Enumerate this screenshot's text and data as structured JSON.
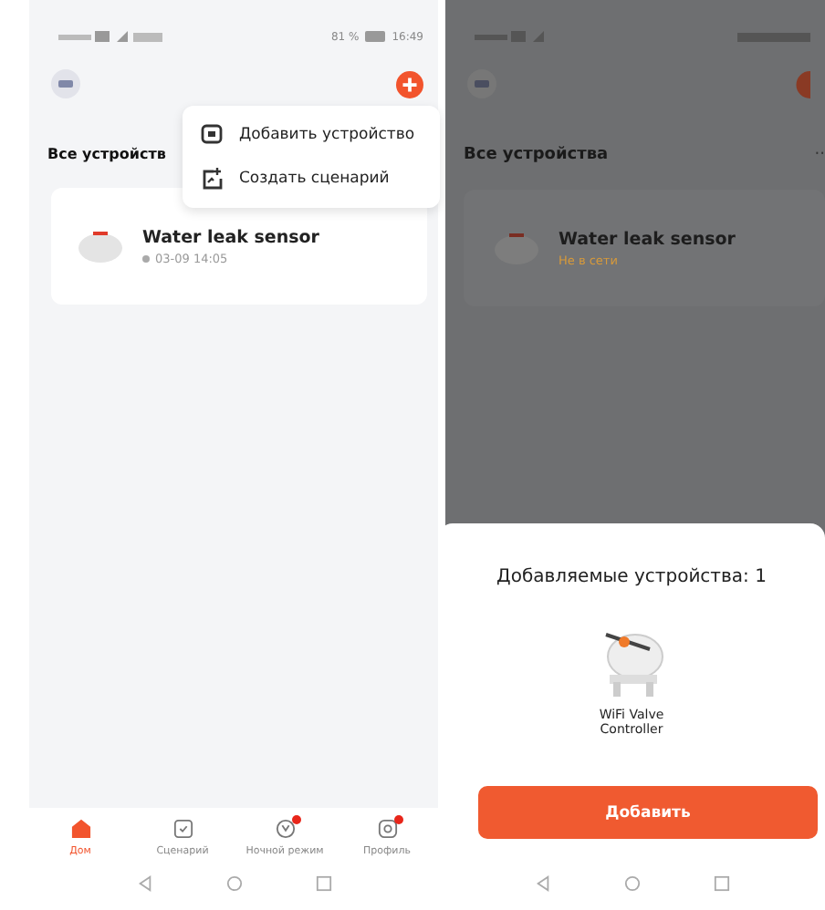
{
  "left_screen": {
    "status_bar": {
      "battery": "81 %",
      "time": "16:49"
    },
    "section_title": "Все устройств",
    "popup_menu": [
      {
        "kind": "device",
        "label": "Добавить устройство"
      },
      {
        "kind": "scene",
        "label": "Создать сценарий"
      }
    ],
    "device": {
      "name": "Water leak sensor",
      "last_seen": "03-09 14:05"
    },
    "tabs": [
      {
        "kind": "home",
        "label": "Дом",
        "selected": true,
        "badge": false
      },
      {
        "kind": "scene",
        "label": "Сценарий",
        "selected": false,
        "badge": false
      },
      {
        "kind": "night",
        "label": "Ночной режим",
        "selected": false,
        "badge": true
      },
      {
        "kind": "profile",
        "label": "Профиль",
        "selected": false,
        "badge": true
      }
    ]
  },
  "right_screen": {
    "section_title": "Все устройства",
    "more": "··",
    "device": {
      "name": "Water leak sensor",
      "status": "Не в сети"
    },
    "sheet": {
      "title": "Добавляемые устройства: 1",
      "device_label": "WiFi Valve Controller",
      "button": "Добавить"
    }
  }
}
